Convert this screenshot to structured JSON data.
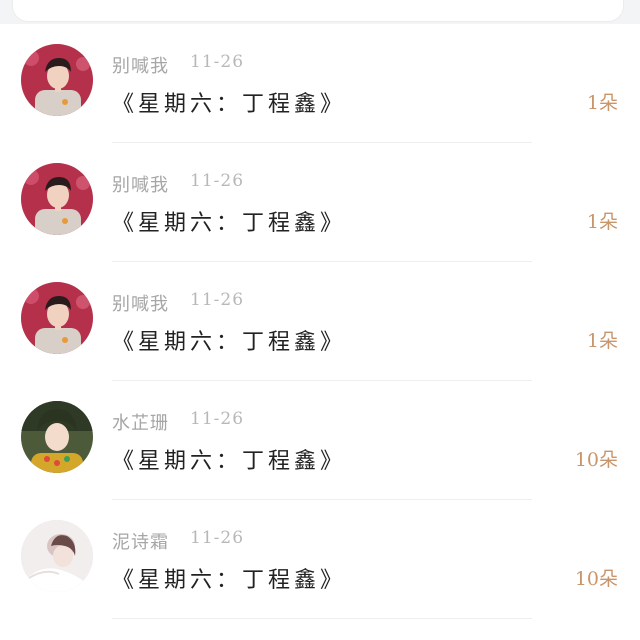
{
  "comments": [
    {
      "user": "别喊我",
      "date": "11-26",
      "text": "《星期六：丁程鑫》",
      "gift": "1朵",
      "avatar": "avatar-boy-red-bg"
    },
    {
      "user": "别喊我",
      "date": "11-26",
      "text": "《星期六：丁程鑫》",
      "gift": "1朵",
      "avatar": "avatar-boy-red-bg"
    },
    {
      "user": "别喊我",
      "date": "11-26",
      "text": "《星期六：丁程鑫》",
      "gift": "1朵",
      "avatar": "avatar-boy-red-bg"
    },
    {
      "user": "水芷珊",
      "date": "11-26",
      "text": "《星期六：丁程鑫》",
      "gift": "10朵",
      "avatar": "avatar-girl-green-bg"
    },
    {
      "user": "泥诗霜",
      "date": "11-26",
      "text": "《星期六：丁程鑫》",
      "gift": "10朵",
      "avatar": "avatar-girl-white-bg"
    }
  ],
  "colors": {
    "gift": "#c9956b",
    "username": "#a6a6a6",
    "text": "#222222"
  }
}
